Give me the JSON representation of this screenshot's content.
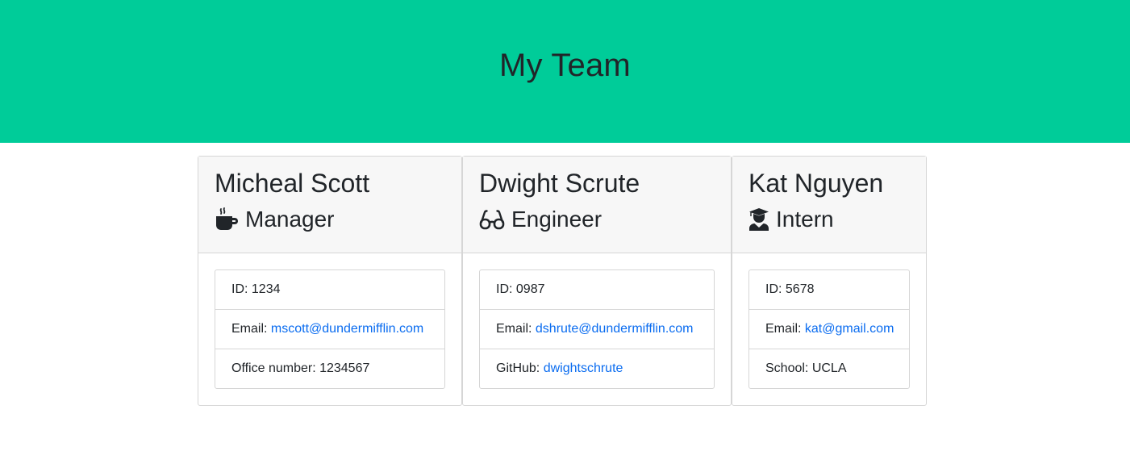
{
  "header": {
    "title": "My Team"
  },
  "employees": [
    {
      "name": "Micheal Scott",
      "role": "Manager",
      "icon": "coffee-icon",
      "id_label": "ID: 1234",
      "email_label": "Email: ",
      "email": "mscott@dundermifflin.com",
      "extra_label": "Office number: 1234567"
    },
    {
      "name": "Dwight Scrute",
      "role": "Engineer",
      "icon": "glasses-icon",
      "id_label": "ID: 0987",
      "email_label": "Email: ",
      "email": "dshrute@dundermifflin.com",
      "extra_label": "GitHub: ",
      "extra_link": "dwightschrute"
    },
    {
      "name": "Kat Nguyen",
      "role": "Intern",
      "icon": "graduate-icon",
      "id_label": "ID: 5678",
      "email_label": "Email: ",
      "email": "kat@gmail.com",
      "extra_label": "School: UCLA"
    }
  ],
  "colors": {
    "header_bg": "#00cc99",
    "link": "#0a6cf0"
  }
}
